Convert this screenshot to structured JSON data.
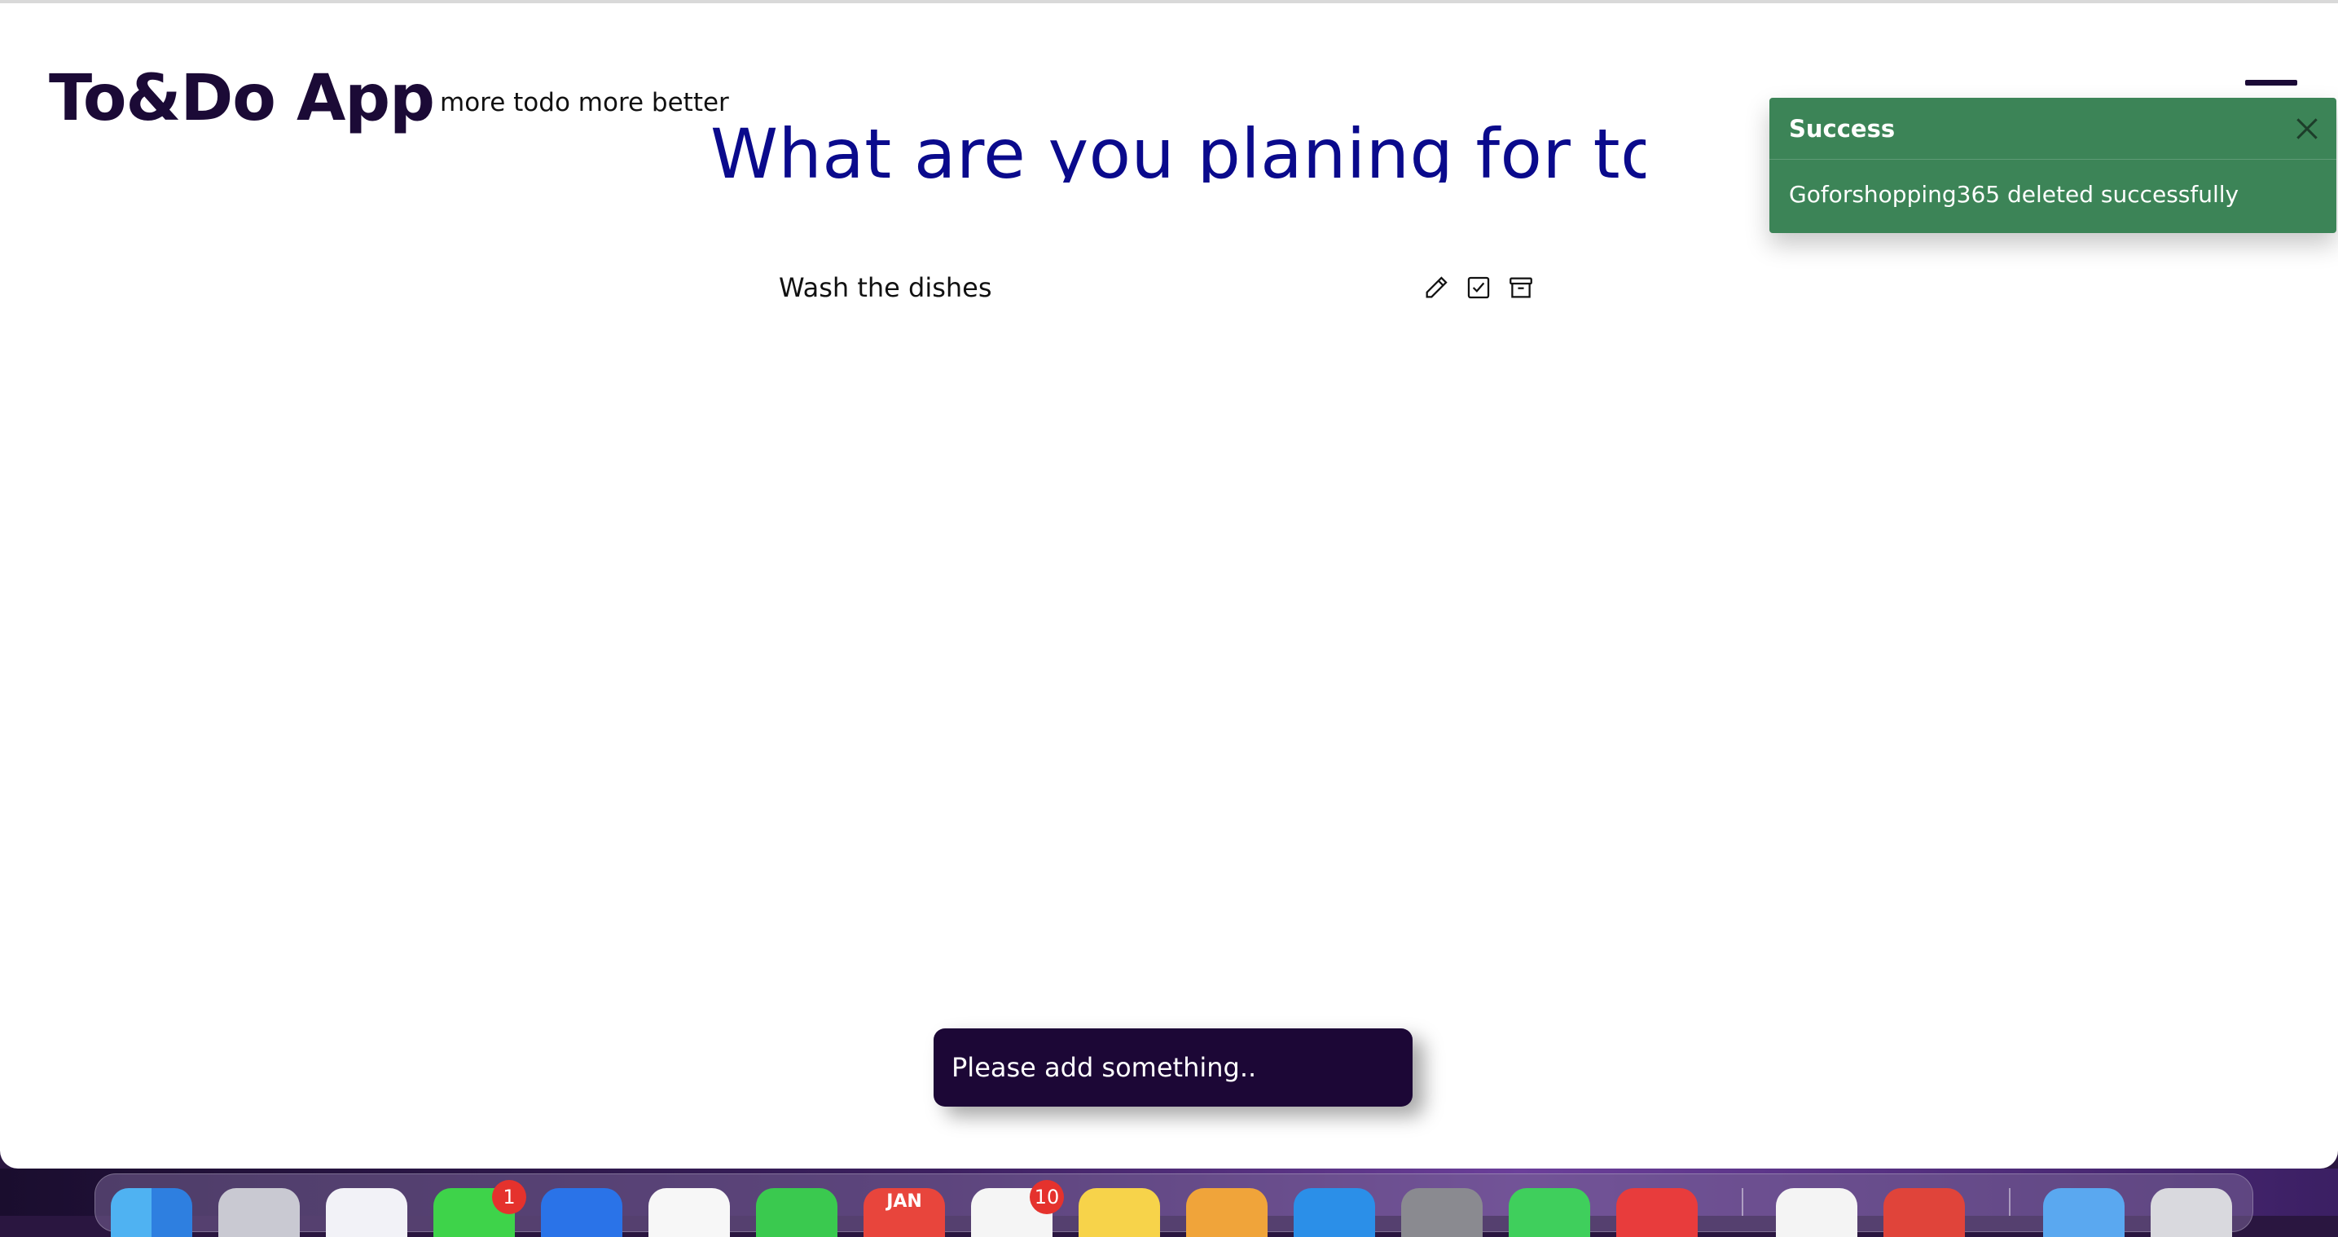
{
  "app": {
    "brand": "To&Do App",
    "tagline": "more todo more better",
    "headline": "What are you planing for today?"
  },
  "todos": [
    {
      "text": "Wash the dishes",
      "actions": [
        "pencil-icon",
        "checkbox-check-icon",
        "archive-icon"
      ]
    }
  ],
  "toast": {
    "title": "Success",
    "message": "Goforshopping365 deleted successfully",
    "color": "#3c8457"
  },
  "snackbar": {
    "message": "Please add something.."
  },
  "dock": {
    "calendar_month": "JAN",
    "badges": {
      "messages": "1",
      "reminders": "10"
    }
  },
  "colors": {
    "brand": "#1b0a36",
    "headline": "#0a0a8c",
    "snackbar": "#1c0736"
  }
}
